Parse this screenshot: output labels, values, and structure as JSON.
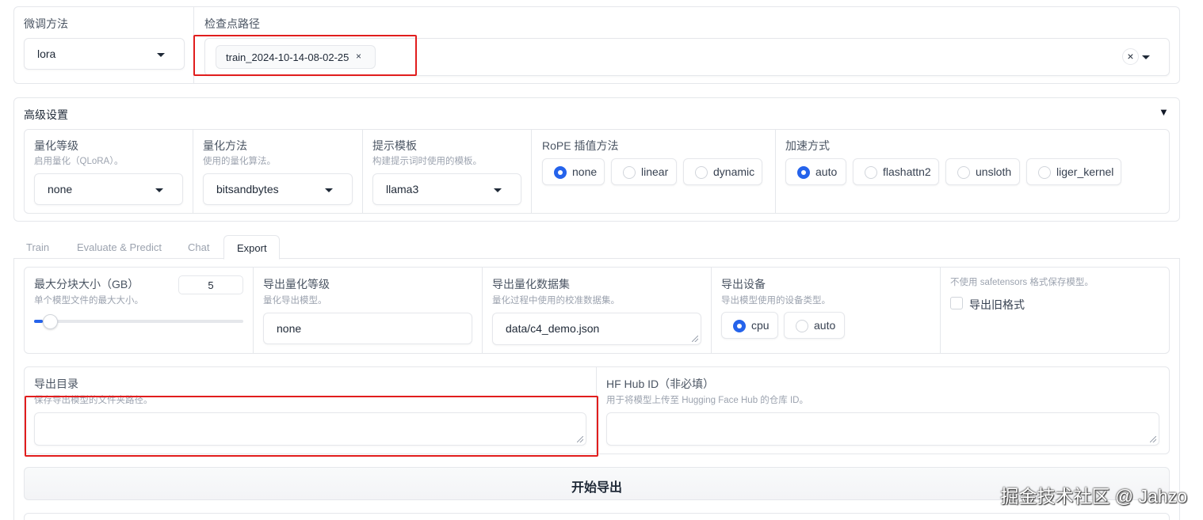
{
  "top": {
    "method_label": "微调方法",
    "method_value": "lora",
    "checkpoint_label": "检查点路径",
    "checkpoint_chip": "train_2024-10-14-08-02-25",
    "chip_remove": "×",
    "clear_icon": "×"
  },
  "advanced": {
    "title": "高级设置",
    "toggle": "▼",
    "quant_bit": {
      "label": "量化等级",
      "desc": "启用量化（QLoRA）。",
      "value": "none"
    },
    "quant_method": {
      "label": "量化方法",
      "desc": "使用的量化算法。",
      "value": "bitsandbytes"
    },
    "template": {
      "label": "提示模板",
      "desc": "构建提示词时使用的模板。",
      "value": "llama3"
    },
    "rope": {
      "label": "RoPE 插值方法",
      "options": [
        "none",
        "linear",
        "dynamic"
      ],
      "selected": "none"
    },
    "booster": {
      "label": "加速方式",
      "options": [
        "auto",
        "flashattn2",
        "unsloth",
        "liger_kernel"
      ],
      "selected": "auto"
    }
  },
  "tabs": [
    "Train",
    "Evaluate & Predict",
    "Chat",
    "Export"
  ],
  "active_tab": "Export",
  "export": {
    "shard": {
      "label": "最大分块大小（GB）",
      "desc": "单个模型文件的最大大小。",
      "value": "5",
      "slider_fraction": 0.04
    },
    "quant_bit": {
      "label": "导出量化等级",
      "desc": "量化导出模型。",
      "value": "none"
    },
    "quant_dataset": {
      "label": "导出量化数据集",
      "desc": "量化过程中使用的校准数据集。",
      "value": "data/c4_demo.json"
    },
    "device": {
      "label": "导出设备",
      "desc": "导出模型使用的设备类型。",
      "options": [
        "cpu",
        "auto"
      ],
      "selected": "cpu"
    },
    "legacy": {
      "desc": "不使用 safetensors 格式保存模型。",
      "label": "导出旧格式",
      "checked": false
    },
    "dir": {
      "label": "导出目录",
      "desc": "保存导出模型的文件夹路径。",
      "value": ""
    },
    "hub": {
      "label": "HF Hub ID（非必填）",
      "desc": "用于将模型上传至 Hugging Face Hub 的仓库 ID。",
      "value": ""
    },
    "button": "开始导出"
  },
  "watermark": "掘金技术社区 @ Jahzo",
  "colors": {
    "accent": "#2563eb",
    "highlight_box": "#e11d1d"
  }
}
